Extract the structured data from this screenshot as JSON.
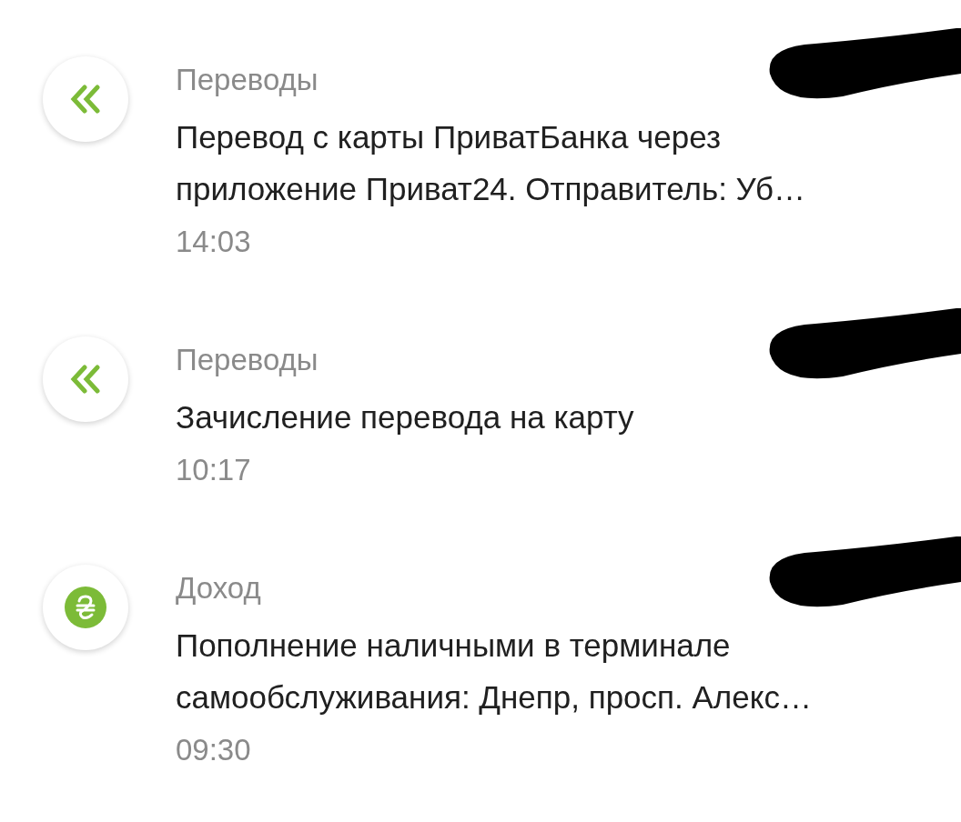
{
  "transactions": [
    {
      "kind": "transfer",
      "category": "Переводы",
      "description": "Перевод с карты ПриватБанка через приложение Приват24. Отправитель: Уб…",
      "time": "14:03",
      "amount_redacted": true
    },
    {
      "kind": "transfer",
      "category": "Переводы",
      "description": "Зачисление перевода на карту",
      "time": "10:17",
      "amount_redacted": true
    },
    {
      "kind": "income",
      "category": "Доход",
      "description": "Пополнение наличными в терминале самообслуживания: Днепр, просп. Алекс…",
      "time": "09:30",
      "amount_redacted": true
    }
  ]
}
